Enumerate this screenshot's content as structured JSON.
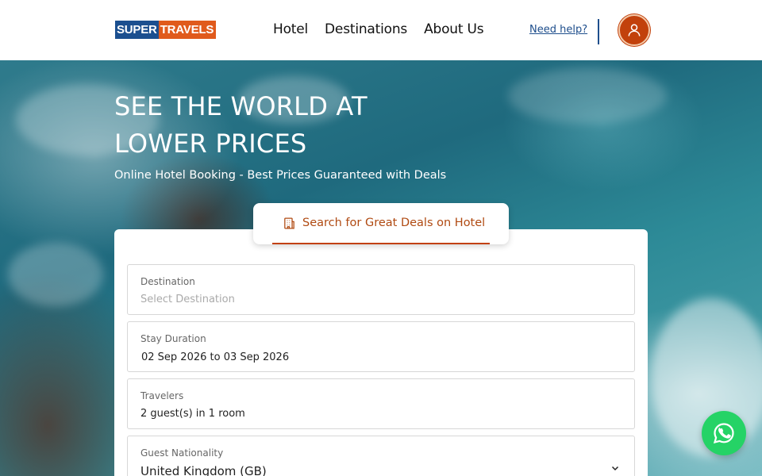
{
  "brand": {
    "logo_part1": "SUPER",
    "logo_part2": "TRAVELS",
    "colors": {
      "primary": "#1b4f8f",
      "accent": "#c2410c",
      "whatsapp": "#25d366"
    }
  },
  "nav": {
    "items": [
      {
        "label": "Hotel"
      },
      {
        "label": "Destinations"
      },
      {
        "label": "About Us"
      }
    ],
    "help_link": "Need help?",
    "avatar_icon": "user-icon"
  },
  "hero": {
    "title": "SEE THE WORLD AT LOWER PRICES",
    "subtitle": "Online Hotel Booking - Best Prices Guaranteed with Deals"
  },
  "search": {
    "tab": {
      "label": "Search for Great Deals on Hotel",
      "icon": "hotel-building-icon"
    },
    "fields": [
      {
        "label": "Destination",
        "placeholder": "Select Destination",
        "value": ""
      },
      {
        "label": "Stay Duration",
        "value": "02 Sep 2026 to 03 Sep 2026"
      },
      {
        "label": "Travelers",
        "value": "2 guest(s) in 1 room"
      },
      {
        "label": "Guest Nationality",
        "value": "United Kingdom (GB)",
        "icon": "chevron-down-icon"
      }
    ]
  },
  "floating": {
    "icon": "whatsapp-icon"
  }
}
